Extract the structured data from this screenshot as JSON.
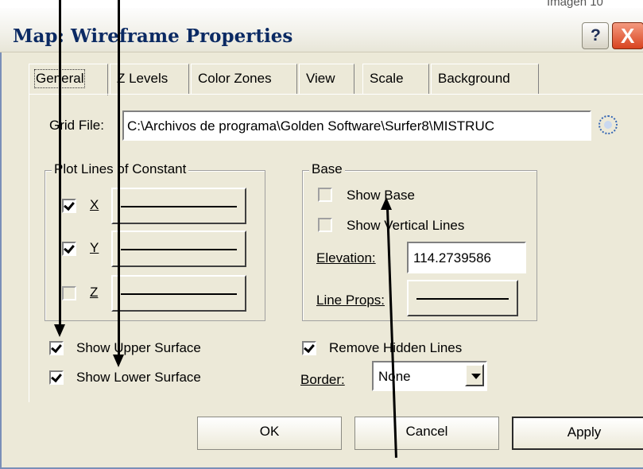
{
  "corner_label": "Imagen 10",
  "window": {
    "title": "Map: Wireframe Properties",
    "help_label": "?",
    "close_label": "X"
  },
  "tabs": [
    "General",
    "Z Levels",
    "Color Zones",
    "View",
    "Scale",
    "Background"
  ],
  "grid_file": {
    "label": "Grid File:",
    "value": "C:\\Archivos de programa\\Golden Software\\Surfer8\\MISTRUC"
  },
  "plot_lines": {
    "title": "Plot Lines of Constant",
    "items": [
      {
        "label": "X",
        "checked": true
      },
      {
        "label": "Y",
        "checked": true
      },
      {
        "label": "Z",
        "checked": false
      }
    ]
  },
  "base": {
    "title": "Base",
    "show_base": {
      "label": "Show Base",
      "checked": false
    },
    "show_vertical_lines": {
      "label": "Show Vertical Lines",
      "checked": false
    },
    "elevation_label": "Elevation:",
    "elevation_value": "114.2739586",
    "line_props_label": "Line Props:"
  },
  "surfaces": {
    "show_upper": {
      "label": "Show Upper Surface",
      "checked": true
    },
    "show_lower": {
      "label": "Show Lower Surface",
      "checked": true
    }
  },
  "remove_hidden": {
    "label": "Remove Hidden Lines",
    "checked": true
  },
  "border": {
    "label": "Border:",
    "value": "None"
  },
  "buttons": {
    "ok": "OK",
    "cancel": "Cancel",
    "apply": "Apply"
  }
}
